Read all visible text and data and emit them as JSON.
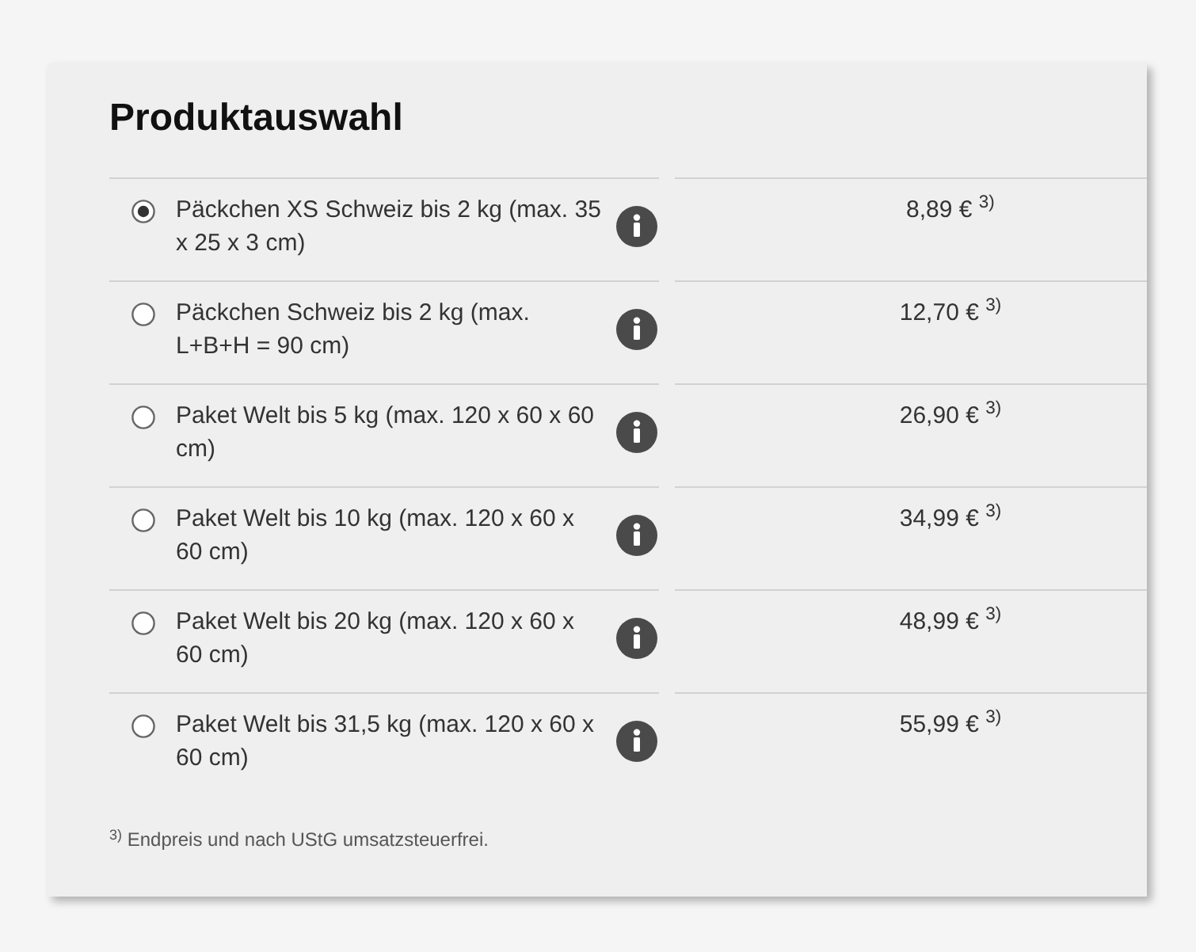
{
  "title": "Produktauswahl",
  "products": [
    {
      "name": "Päckchen XS Schweiz bis 2 kg (max. 35 x 25 x 3 cm)",
      "selected": true,
      "price": "8,89 € $^{3)}$"
    },
    {
      "name": "Päckchen Schweiz bis 2 kg (max. L+B+H = 90 cm)",
      "selected": false,
      "price": "12,70 € $^{3)}$"
    },
    {
      "name": "Paket Welt bis 5 kg (max. 120 x 60 x 60 cm)",
      "selected": false,
      "price": "26,90 € $^{3)}$"
    },
    {
      "name": "Paket Welt bis 10 kg (max. 120 x 60 x 60 cm)",
      "selected": false,
      "price": "34,99 € $^{3)}$"
    },
    {
      "name": "Paket Welt bis 20 kg (max. 120 x 60 x 60 cm)",
      "selected": false,
      "price": "48,99 € $^{3)}$"
    },
    {
      "name": "Paket Welt bis 31,5 kg (max. 120 x 60 x 60 cm)",
      "selected": false,
      "price": "55,99 € $^{3)}$"
    }
  ],
  "footnote": "$^{3)}$ Endpreis und nach UStG umsatzsteuerfrei."
}
